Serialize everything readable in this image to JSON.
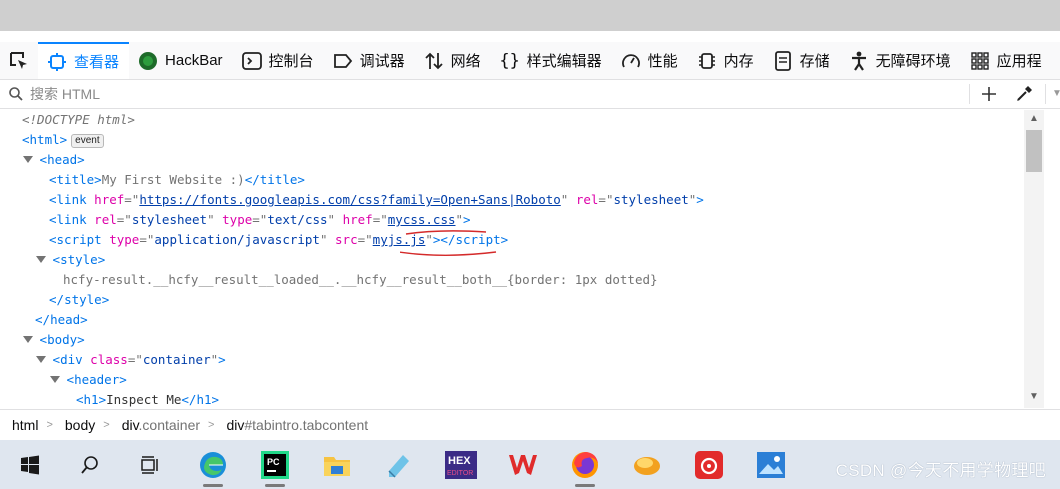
{
  "toolbar": {
    "tabs": [
      {
        "label": "查看器",
        "icon": "inspector-icon"
      },
      {
        "label": "HackBar",
        "icon": "hackbar-icon"
      },
      {
        "label": "控制台",
        "icon": "console-icon"
      },
      {
        "label": "调试器",
        "icon": "debugger-icon"
      },
      {
        "label": "网络",
        "icon": "network-icon"
      },
      {
        "label": "样式编辑器",
        "icon": "style-editor-icon"
      },
      {
        "label": "性能",
        "icon": "performance-icon"
      },
      {
        "label": "内存",
        "icon": "memory-icon"
      },
      {
        "label": "存储",
        "icon": "storage-icon"
      },
      {
        "label": "无障碍环境",
        "icon": "accessibility-icon"
      },
      {
        "label": "应用程",
        "icon": "application-icon"
      }
    ],
    "active_tab": "查看器",
    "accent": "#0a84ff"
  },
  "search": {
    "placeholder": "搜索 HTML"
  },
  "tree": {
    "doctype": "<!DOCTYPE html>",
    "html_tag": "html",
    "event_badge": "event",
    "head_tag": "head",
    "title_tag": "title",
    "title_text": "My First Website :)",
    "link1": {
      "tag": "link",
      "attr": "href",
      "value": "https://fonts.googleapis.com/css?family=Open+Sans|Roboto",
      "attr2": "rel",
      "value2": "stylesheet"
    },
    "link2": {
      "tag": "link",
      "attr1": "rel",
      "value1": "stylesheet",
      "attr2": "type",
      "value2": "text/css",
      "attr3": "href",
      "value3": "mycss.css"
    },
    "script": {
      "tag": "script",
      "attr1": "type",
      "value1": "application/javascript",
      "attr2": "src",
      "value2": "myjs.js"
    },
    "style_tag": "style",
    "style_text": "hcfy-result.__hcfy__result__loaded__.__hcfy__result__both__{border: 1px dotted}",
    "body_tag": "body",
    "div_tag": "div",
    "div_attr": "class",
    "div_value": "container",
    "header_tag": "header",
    "h1_tag": "h1",
    "h1_text": "Inspect Me"
  },
  "breadcrumbs": [
    {
      "tag": "html",
      "cls": ""
    },
    {
      "tag": "body",
      "cls": ""
    },
    {
      "tag": "div",
      "cls": ".container"
    },
    {
      "tag": "div",
      "cls": "#tabintro.tabcontent"
    }
  ],
  "taskbar": {
    "icons": [
      "windows-start-icon",
      "search-icon",
      "task-view-icon",
      "edge-icon",
      "pycharm-icon",
      "file-explorer-icon",
      "notepad-icon",
      "hex-editor-icon",
      "wps-icon",
      "firefox-icon",
      "tool-icon",
      "netease-music-icon",
      "photos-icon"
    ],
    "watermark": "CSDN @今天不用学物理吧"
  }
}
